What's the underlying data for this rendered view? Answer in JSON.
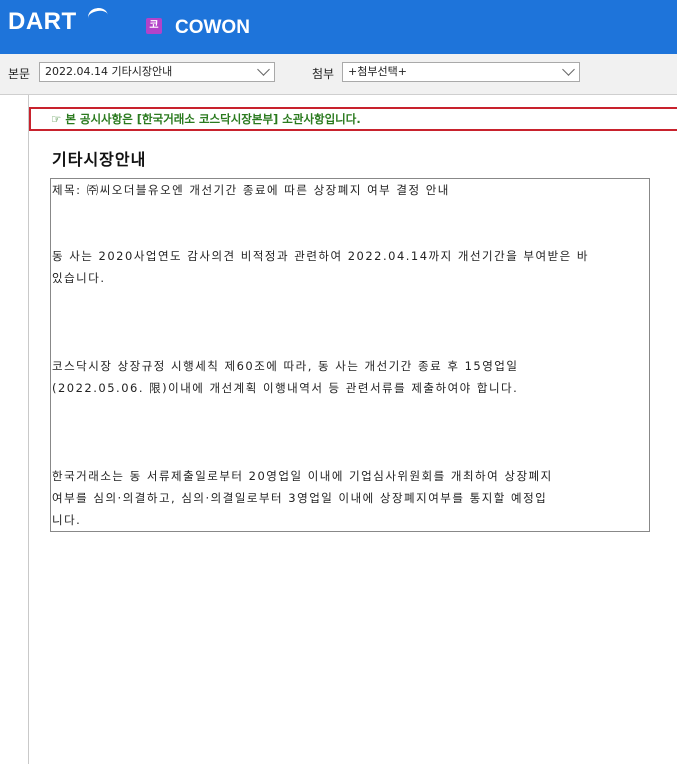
{
  "header": {
    "logo": "DART",
    "corp_badge": "코",
    "corp_name": "COWON"
  },
  "toolbar": {
    "body_label": "본문",
    "body_select": "2022.04.14  기타시장안내",
    "attach_label": "첨부",
    "attach_select": "+첨부선택+"
  },
  "notice": "☞ 본 공시사항은 [한국거래소 코스닥시장본부] 소관사항입니다.",
  "document": {
    "title": "기타시장안내",
    "subject": "제목: ㈜씨오더블유오엔 개선기간 종료에 따른 상장폐지 여부 결정 안내",
    "para1_line1": "동 사는 2020사업연도 감사의견 비적정과 관련하여 2022.04.14까지 개선기간을 부여받은 바",
    "para1_line2": "있습니다.",
    "para2_line1": "코스닥시장 상장규정 시행세칙 제60조에 따라, 동 사는 개선기간 종료 후 15영업일",
    "para2_line2": "(2022.05.06. 限)이내에 개선계획 이행내역서 등 관련서류를 제출하여야 합니다.",
    "para3_line1": "한국거래소는 동 서류제출일로부터 20영업일 이내에 기업심사위원회를 개최하여 상장폐지",
    "para3_line2": "여부를 심의·의결하고, 심의·의결일로부터 3영업일 이내에 상장폐지여부를 통지할 예정입",
    "para3_line3": "니다."
  }
}
